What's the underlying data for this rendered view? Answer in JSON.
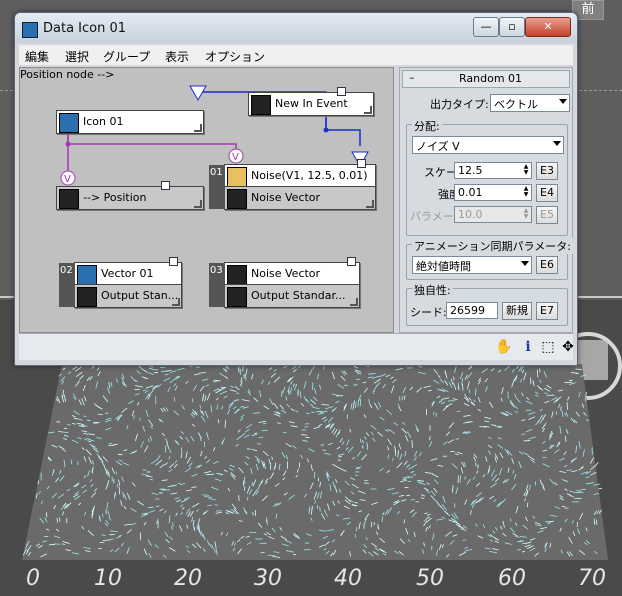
{
  "window": {
    "title": "Data Icon 01",
    "controls": {
      "minimize": "—",
      "maximize": "▫",
      "close": "✕"
    }
  },
  "menu": [
    "編集",
    "選択",
    "グループ",
    "表示",
    "オプション"
  ],
  "viewport": {
    "cube_label": "前",
    "ruler": [
      "0",
      "10",
      "20",
      "30",
      "40",
      "50",
      "60",
      "70"
    ]
  },
  "nodes": {
    "icon01": {
      "label": "Icon 01"
    },
    "new_in_event": {
      "label": "New In Event"
    },
    "position": {
      "label": "--> Position"
    },
    "noise": {
      "number": "01",
      "label": "Noise(V1, 12.5, 0.01)",
      "output": "Noise Vector"
    },
    "vector01": {
      "number": "02",
      "label": "Vector 01",
      "output": "Output Stan..."
    },
    "noise_vector": {
      "number": "03",
      "label": "Noise Vector",
      "output": "Output Standar..."
    },
    "v_badge": "V"
  },
  "panel": {
    "collapse": "–",
    "title": "Random 01",
    "output_type_label": "出力タイプ:",
    "output_type_value": "ベクトル",
    "distribution_label": "分配:",
    "distribution_value": "ノイズ V",
    "scale_label": "スケール:",
    "scale_value": "12.5",
    "scale_btn": "E3",
    "strength_label": "強度:",
    "strength_value": "0.01",
    "strength_btn": "E4",
    "param3_label": "パラメータ 3:",
    "param3_value": "10.0",
    "param3_btn": "E5",
    "anim_sync_label": "アニメーション同期パラメータ:",
    "anim_sync_value": "絶対値時間",
    "anim_sync_btn": "E6",
    "uniqueness_label": "独自性:",
    "seed_label": "シード:",
    "seed_value": "26599",
    "new_btn": "新規",
    "seed_btn": "E7"
  },
  "status_icons": [
    "pan-hand-icon",
    "info-icon",
    "fit-icon",
    "move-icon"
  ]
}
